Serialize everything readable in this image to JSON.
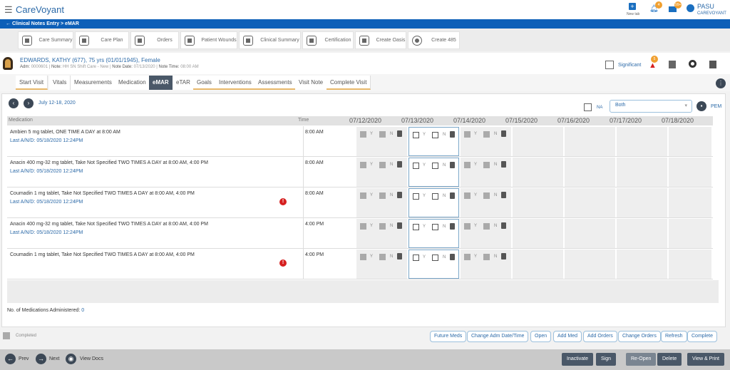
{
  "app": {
    "title": "CareVoyant",
    "new_tab": "New tab",
    "notif_count": "4",
    "mail_count": "99+",
    "user": "PASU",
    "org": "CAREVOYANT"
  },
  "breadcrumb": "Clinical Notes Entry > eMAR",
  "toolbar": [
    "Care Summary",
    "Care Plan",
    "Orders",
    "Patient Wounds",
    "Clinical Summary",
    "Certification",
    "Create Oasis",
    "Create 485"
  ],
  "patient": {
    "name": "EDWARDS, KATHY (677), 75 yrs (01/01/1945), Female",
    "adm_label": "Adm:",
    "adm": "0000601",
    "note_label": "Note:",
    "note": "HH SN Shift Care - New",
    "date_label": "Note Date:",
    "date": "07/13/2020",
    "time_label": "Note Time:",
    "time": "08:00 AM",
    "significant": "Significant",
    "alert_count": "5"
  },
  "tabs": [
    "Start Visit",
    "Vitals",
    "Measurements",
    "Medication",
    "eMAR",
    "eTAR",
    "Goals",
    "Interventions",
    "Assessments",
    "Visit Note",
    "Complete Visit"
  ],
  "emar": {
    "range": "July 12-18, 2020",
    "na": "NA",
    "filter": "Both",
    "pem": "PEM",
    "headers": {
      "medication": "Medication",
      "time": "Time"
    },
    "dates": [
      "07/12/2020",
      "07/13/2020",
      "07/14/2020",
      "07/15/2020",
      "07/16/2020",
      "07/17/2020",
      "07/18/2020"
    ],
    "yes": "Y",
    "no": "N",
    "rows": [
      {
        "med": "Ambien 5 mg tablet, ONE TIME A DAY at 8:00 AM",
        "last": "Last A/N/D: 05/18/2020 12:24PM",
        "time": "8:00 AM",
        "warn": false
      },
      {
        "med": "Anacin 400 mg-32 mg tablet, Take Not Specified TWO TIMES A DAY at 8:00 AM, 4:00 PM",
        "last": "Last A/N/D: 05/18/2020 12:24PM",
        "time": "8:00 AM",
        "warn": false
      },
      {
        "med": "Coumadin 1 mg tablet, Take Not Specified TWO TIMES A DAY at 8:00 AM, 4:00 PM",
        "last": "Last A/N/D: 05/18/2020 12:24PM",
        "time": "8:00 AM",
        "warn": true
      },
      {
        "med": "Anacin 400 mg-32 mg tablet, Take Not Specified TWO TIMES A DAY at 8:00 AM, 4:00 PM",
        "last": "Last A/N/D: 05/18/2020 12:24PM",
        "time": "4:00 PM",
        "warn": false
      },
      {
        "med": "Coumadin 1 mg tablet, Take Not Specified TWO TIMES A DAY at 8:00 AM, 4:00 PM",
        "last": "",
        "time": "4:00 PM",
        "warn": true
      }
    ],
    "administered_label": "No. of Medications Administered:",
    "administered": "0"
  },
  "legend": {
    "completed": "Completed"
  },
  "actions": [
    "Future Meds",
    "Change Adm Date/Time",
    "Open",
    "Add Med",
    "Add Orders",
    "Change Orders",
    "Refresh",
    "Complete"
  ],
  "footer": {
    "prev": "Prev",
    "next": "Next",
    "view_docs": "View Docs",
    "buttons": [
      "Inactivate",
      "Sign",
      "Re-Open",
      "Delete",
      "View & Print"
    ]
  }
}
